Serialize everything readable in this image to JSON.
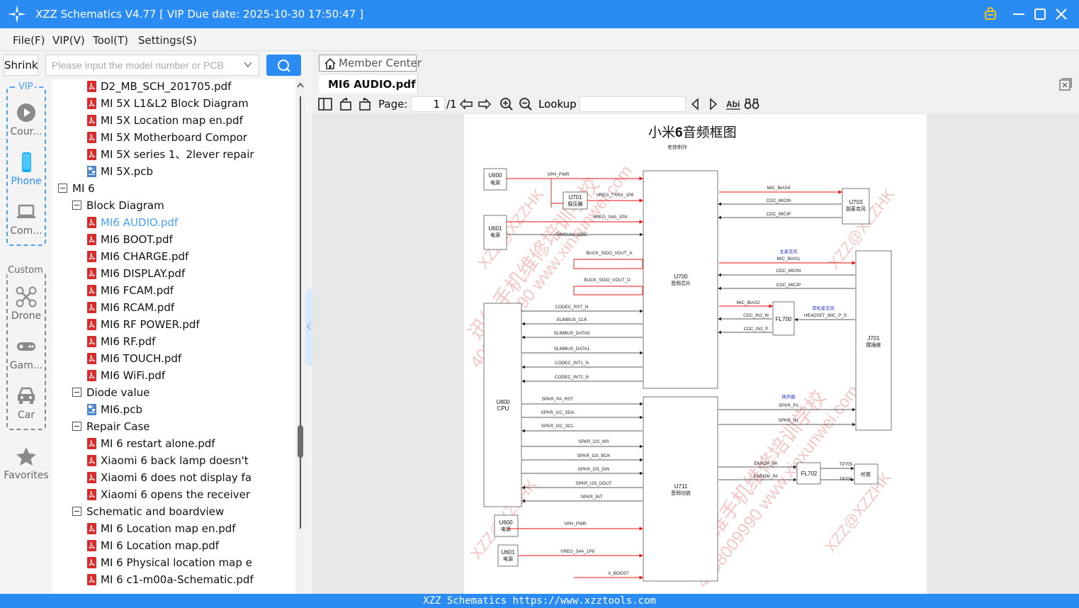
{
  "app": {
    "title": "XZZ Schematics V4.77 [ VIP Due date: 2025-10-30 17:50:47 ]",
    "brand_color": "#2a8bf2"
  },
  "titlebar_icons": [
    "bag-icon",
    "minimize-icon",
    "maximize-icon",
    "close-icon"
  ],
  "menu": [
    "File(F)",
    "VIP(V)",
    "Tool(T)",
    "Settings(S)"
  ],
  "left": {
    "shrink_label": "Shrink",
    "search_placeholder": "Please input the model number or PCB",
    "vip_label": "VIP",
    "custom_label": "Custom",
    "categories": [
      {
        "label": "Cour...",
        "icon": "play-icon"
      },
      {
        "label": "Phone",
        "icon": "phone-icon",
        "active": true
      },
      {
        "label": "Com...",
        "icon": "laptop-icon"
      },
      {
        "label": "Drone",
        "icon": "drone-icon"
      },
      {
        "label": "Gam...",
        "icon": "gamepad-icon"
      },
      {
        "label": "Car",
        "icon": "car-icon"
      },
      {
        "label": "Favorites",
        "icon": "star-icon"
      }
    ]
  },
  "tree": [
    {
      "label": "D2_MB_SCH_201705.pdf",
      "type": "pdf"
    },
    {
      "label": "MI 5X L1&L2 Block Diagram",
      "type": "pdf"
    },
    {
      "label": "MI 5X Location map en.pdf",
      "type": "pdf"
    },
    {
      "label": "MI 5X Motherboard Compor",
      "type": "pdf"
    },
    {
      "label": "MI 5X series 1、2lever repair",
      "type": "pdf"
    },
    {
      "label": "MI 5X.pcb",
      "type": "pcb"
    },
    {
      "label": "MI 6",
      "type": "folder"
    },
    {
      "label": "Block Diagram",
      "type": "folder"
    },
    {
      "label": "MI6 AUDIO.pdf",
      "type": "pdf",
      "selected": true
    },
    {
      "label": "MI6 BOOT.pdf",
      "type": "pdf"
    },
    {
      "label": "MI6 CHARGE.pdf",
      "type": "pdf"
    },
    {
      "label": "MI6 DISPLAY.pdf",
      "type": "pdf"
    },
    {
      "label": "MI6 FCAM.pdf",
      "type": "pdf"
    },
    {
      "label": "MI6 RCAM.pdf",
      "type": "pdf"
    },
    {
      "label": "MI6 RF POWER.pdf",
      "type": "pdf"
    },
    {
      "label": "MI6 RF.pdf",
      "type": "pdf"
    },
    {
      "label": "MI6 TOUCH.pdf",
      "type": "pdf"
    },
    {
      "label": "MI6 WiFi.pdf",
      "type": "pdf"
    },
    {
      "label": "Diode value",
      "type": "folder"
    },
    {
      "label": "MI6.pcb",
      "type": "pcb"
    },
    {
      "label": "Repair Case",
      "type": "folder"
    },
    {
      "label": "MI 6 restart alone.pdf",
      "type": "pdf"
    },
    {
      "label": "Xiaomi 6 back lamp doesn't",
      "type": "pdf"
    },
    {
      "label": "Xiaomi 6 does not display fa",
      "type": "pdf"
    },
    {
      "label": "Xiaomi 6 opens the receiver",
      "type": "pdf"
    },
    {
      "label": "Schematic and boardview",
      "type": "folder"
    },
    {
      "label": "MI 6 Location map en.pdf",
      "type": "pdf"
    },
    {
      "label": "MI 6 Location map.pdf",
      "type": "pdf"
    },
    {
      "label": "MI 6 Physical location map e",
      "type": "pdf"
    },
    {
      "label": "MI 6 c1-m00a-Schematic.pdf",
      "type": "pdf"
    }
  ],
  "right": {
    "member_center": "Member Center",
    "tab_title": "MI6 AUDIO.pdf",
    "page_label": "Page:",
    "page_current": "1",
    "page_total": "/1",
    "lookup_label": "Lookup",
    "lookup_value": ""
  },
  "schematic": {
    "title_a": "小米",
    "title_b": "6",
    "title_c": "音频框图",
    "author": "老铁制作",
    "watermark_1": "迅维手机维修培训学校",
    "watermark_2": "4008009990 www.xinxunwei.com",
    "watermark_3": "XZZ@XZZHK",
    "u600": "U600",
    "u600_sub": "电源",
    "u601": "U601",
    "u601_sub": "电源",
    "u701": "U701",
    "u701_sub": "稳压器",
    "u700": "U700",
    "u700_sub": "音频芯片",
    "u703": "U703",
    "u703_sub": "副麦克风",
    "u800": "U800",
    "u800_sub": "CPU",
    "fl700": "FL700",
    "j701": "J701",
    "j701_sub": "尾插座",
    "u711": "U711",
    "u711_sub": "音频功放",
    "fl702": "FL702",
    "receiver": "听筒",
    "main_mic": "主麦克风",
    "ear_mic": "耳机麦克风",
    "speaker": "扬声器",
    "nets": {
      "vph_pwr": "VPH_PWR",
      "vreg_txrx": "VREG_TXRX_1P8",
      "vreg_s4a": "VREG_S4A_1P8",
      "divclk": "DIVCLK1_CDC",
      "buck_a": "BUCK_SIDO_VOUT_A",
      "buck_d": "BUCK_SIDO_VOUT_D",
      "codec_rst": "CODEC_RST_N",
      "slim_clk": "SLIMBUS_CLK",
      "slim_d0": "SLIMBUS_DATA0",
      "slim_d1": "SLIMBUS_DATA1",
      "int1": "CODEC_INT1_N",
      "int2": "CODEC_INT2_N",
      "mic_bias4": "MIC_BIAS4",
      "cdc_micin": "CDC_MICIN",
      "cdc_micip": "CDC_MICIP",
      "mic_bias1": "MIC_BIAS1",
      "mic_bias2": "MIC_BIAS2",
      "cdc_in2m": "CDC_IN2_M",
      "cdc_in2p": "CDC_IN2_P",
      "headset": "HEADSET_MIC_P_S",
      "spkr_rst": "SPKR_PA_RST",
      "spkr_sda": "SPKR_I2C_SDA",
      "spkr_scl": "SPKR_I2C_SCL",
      "spkr_ws": "SPKR_I2S_WS",
      "spkr_bck": "SPKR_I2S_BCK",
      "spkr_din": "SPKR_I2S_DIN",
      "spkr_dout": "SPKR_I2S_DOUT",
      "spkr_int": "SPKR_INT",
      "spkr_p1": "SPKR_P1",
      "spkr_n1": "SPKR_N1",
      "earop": "EAROP_PA",
      "earom": "EAROM_PA",
      "tp705": "TP705",
      "tp706": "TP706",
      "vph_pwr2": "VPH_PWR",
      "vreg_s4a2": "VREG_S4A_1P8",
      "v_boost": "V_BOOST"
    }
  },
  "status": "XZZ Schematics https://www.xzztools.com"
}
